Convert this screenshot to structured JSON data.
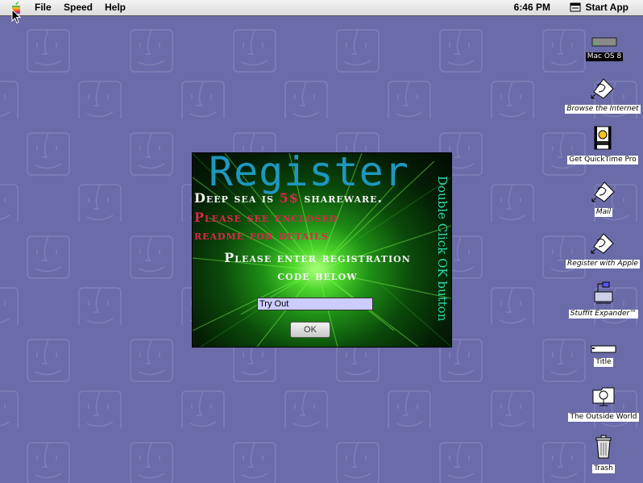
{
  "menubar": {
    "items": [
      {
        "label": "File"
      },
      {
        "label": "Speed"
      },
      {
        "label": "Help"
      }
    ],
    "clock": "6:46 PM",
    "app_menu": "Start App"
  },
  "desktop_icons": [
    {
      "name": "disk-mac-os-8",
      "label": "Mac OS 8",
      "icon": "hard-disk-icon",
      "selected": true
    },
    {
      "name": "browse-internet",
      "label": "Browse the Internet",
      "icon": "alias-hand-icon",
      "italic": true
    },
    {
      "name": "get-quicktime-pro",
      "label": "Get QuickTime Pro",
      "icon": "quicktime-movie-icon"
    },
    {
      "name": "mail",
      "label": "Mail",
      "icon": "alias-hand-icon",
      "italic": true
    },
    {
      "name": "register-with-apple",
      "label": "Register with Apple",
      "icon": "alias-hand-icon",
      "italic": true
    },
    {
      "name": "stuffit-expander",
      "label": "StuffIt Expander™",
      "icon": "stuffit-icon",
      "italic": true
    },
    {
      "name": "title",
      "label": "Title",
      "icon": "document-icon"
    },
    {
      "name": "outside-world",
      "label": "The Outside World",
      "icon": "network-folder-icon"
    },
    {
      "name": "trash",
      "label": "Trash",
      "icon": "trash-icon"
    }
  ],
  "dialog": {
    "title": "Register",
    "line1_prefix": "Deep sea is ",
    "line1_price": "5$",
    "line1_suffix": " shareware.",
    "line2": "Please see enclosed",
    "line3": "readme for details",
    "line4": "Please enter registration",
    "line5": "code below",
    "input_value": "Try Out",
    "ok_label": "OK",
    "vertical_hint": "Double Click OK button"
  },
  "colors": {
    "desktop": "#6b6ba9",
    "title": "#1e97bf",
    "accent_red": "#e0264b",
    "hint": "#2fd9b0"
  }
}
